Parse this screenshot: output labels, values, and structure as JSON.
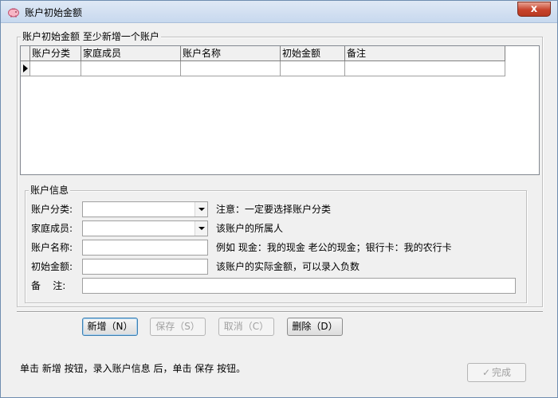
{
  "window": {
    "title": "账户初始金额",
    "close_label": "x"
  },
  "accounts_group": {
    "legend": "账户初始金额 至少新增一个账户",
    "columns": [
      "账户分类",
      "家庭成员",
      "账户名称",
      "初始金额",
      "备注"
    ],
    "rows": [
      [
        "",
        "",
        "",
        "",
        ""
      ]
    ]
  },
  "info_group": {
    "legend": "账户信息",
    "fields": {
      "category": {
        "label": "账户分类:",
        "value": "",
        "hint": "注意：一定要选择账户分类"
      },
      "member": {
        "label": "家庭成员:",
        "value": "",
        "hint": "该账户的所属人"
      },
      "name": {
        "label": "账户名称:",
        "value": "",
        "hint": "例如 现金：我的现金 老公的现金；银行卡：我的农行卡"
      },
      "amount": {
        "label": "初始金额:",
        "value": "",
        "hint": "该账户的实际金额，可以录入负数"
      },
      "note": {
        "label": "备    注:",
        "value": ""
      }
    }
  },
  "buttons": {
    "add": "新增（N）",
    "save": "保存（S）",
    "cancel": "取消（C）",
    "delete": "删除（D）"
  },
  "status": "单击 新增 按钮，录入账户信息 后，单击 保存 按钮。",
  "finish": {
    "label": "完成",
    "icon": "check-icon"
  }
}
